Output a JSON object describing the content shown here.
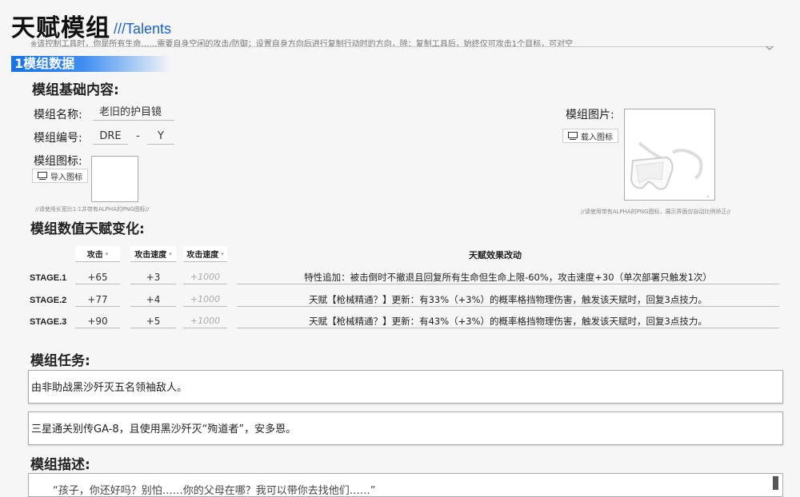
{
  "header": {
    "title": "天赋模组",
    "subtitle": "///Talents",
    "hint": "※该控制工具时，你是所有生命……需要自身空闲的攻击/防御；设置自身方向后进行复制行动时的方向，除：复制工具后，始终仅可攻击1个目标，可对空"
  },
  "section1": {
    "label": "1模组数据"
  },
  "basic": {
    "heading": "模组基础内容:",
    "name_label": "模组名称:",
    "name_value": "老旧的护目镜",
    "code_label": "模组编号:",
    "code_prefix": "DRE",
    "code_sep": "-",
    "code_suffix": "Y",
    "icon_label": "模组图标:",
    "icon_button": "导入图标",
    "icon_hint": "//请使用长宽比1:1并带有ALPHA的PNG图标//",
    "image_label": "模组图片:",
    "image_button": "载入图标",
    "image_hint": "//请使用带有ALPHA的PNG图标，展示界面仅自动比例矫正//"
  },
  "stats": {
    "heading": "模组数值天赋变化:",
    "columns": [
      "攻击",
      "攻击速度",
      "攻击速度"
    ],
    "effect_header": "天赋效果改动",
    "rows": [
      {
        "stage": "STAGE.1",
        "v1": "+65",
        "v2": "+3",
        "v3": "+1000",
        "effect": "特性追加：被击倒时不撤退且回复所有生命但生命上限-60%，攻击速度+30（单次部署只触发1次）"
      },
      {
        "stage": "STAGE.2",
        "v1": "+77",
        "v2": "+4",
        "v3": "+1000",
        "effect": "天赋【枪械精通？】更新：有33%（+3%）的概率格挡物理伤害，触发该天赋时，回复3点技力。"
      },
      {
        "stage": "STAGE.3",
        "v1": "+90",
        "v2": "+5",
        "v3": "+1000",
        "effect": "天赋【枪械精通？】更新：有43%（+3%）的概率格挡物理伤害，触发该天赋时，回复3点技力。"
      }
    ]
  },
  "tasks": {
    "heading": "模组任务:",
    "items": [
      "由非助战黑沙歼灭五名领袖敌人。",
      "三星通关别传GA-8，且使用黑沙歼灭“殉道者”，安多恩。"
    ]
  },
  "description": {
    "heading": "模组描述:",
    "text": "“孩子，你还好吗？别怕……你的父母在哪？我可以带你去找他们……”"
  }
}
